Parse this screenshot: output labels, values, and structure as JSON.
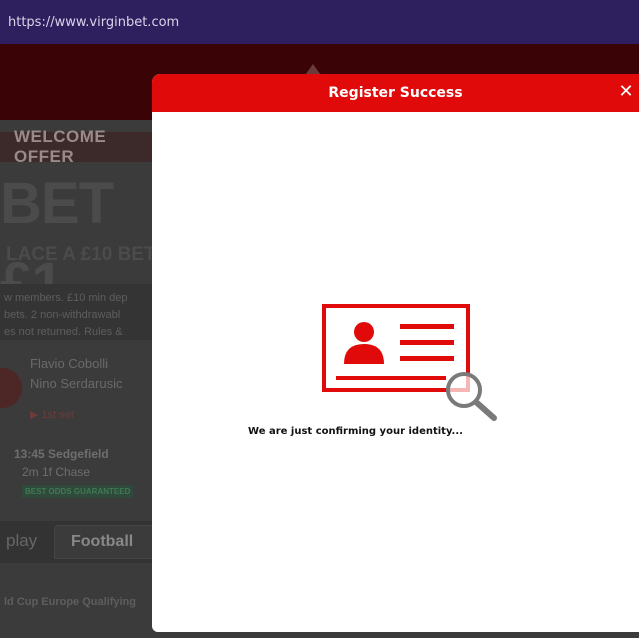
{
  "browser": {
    "url": "https://www.virginbet.com"
  },
  "background": {
    "welcome_offer": "WELCOME OFFER",
    "bet_headline": "BET £1",
    "place_bet": "LACE A £10 BET &",
    "members_lines": [
      "w members. £10 min dep",
      "bets. 2 non-withdrawabl",
      "es not returned. Rules &"
    ],
    "match": {
      "player1": "Flavio Cobolli",
      "player2": "Nino Serdarusic",
      "set": "1st set"
    },
    "race": {
      "title": "13:45 Sedgefield",
      "subtitle": "2m 1f Chase",
      "badge": "BEST ODDS GUARANTEED"
    },
    "tabs": {
      "inplay": "play",
      "football": "Football"
    },
    "competition": "ld Cup Europe Qualifying"
  },
  "modal": {
    "title": "Register Success",
    "close_label": "✕",
    "message": "We are just confirming your identity...",
    "icon": "id-card-search-icon",
    "accent_color": "#e10a0a"
  }
}
